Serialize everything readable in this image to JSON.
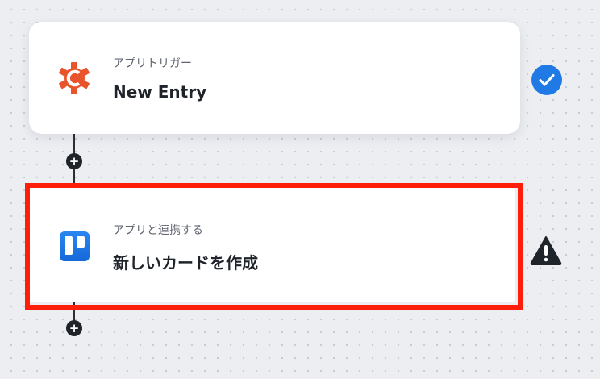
{
  "colors": {
    "canvas": "#eceef2",
    "connector": "#2b2f36",
    "trigger_app_icon": "#e8542b",
    "action_app_icon": "#1f7ae6",
    "check_badge": "#1f7ae6",
    "warning_badge": "#1f232a",
    "highlight": "#ff1e0a"
  },
  "steps": [
    {
      "step_type": "アプリトリガー",
      "action": "New Entry",
      "app_icon": "cognito-forms-gear-icon",
      "status": "completed",
      "status_icon": "check-circle-icon"
    },
    {
      "step_type": "アプリと連携する",
      "action": "新しいカードを作成",
      "app_icon": "trello-board-icon",
      "status": "warning",
      "status_icon": "warning-triangle-icon"
    }
  ],
  "add_step_symbol": "+"
}
